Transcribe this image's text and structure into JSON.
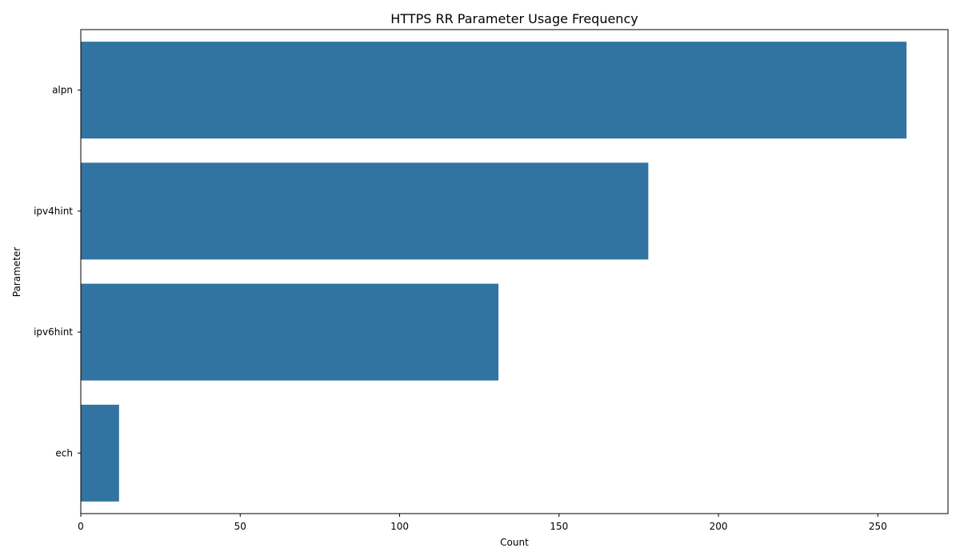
{
  "chart_data": {
    "type": "bar",
    "orientation": "horizontal",
    "title": "HTTPS RR Parameter Usage Frequency",
    "xlabel": "Count",
    "ylabel": "Parameter",
    "categories": [
      "alpn",
      "ipv4hint",
      "ipv6hint",
      "ech"
    ],
    "values": [
      259,
      178,
      131,
      12
    ],
    "xlim": [
      0,
      272
    ],
    "xticks": [
      0,
      50,
      100,
      150,
      200,
      250
    ],
    "bar_color": "#3274a1",
    "grid": false,
    "legend": "none"
  }
}
